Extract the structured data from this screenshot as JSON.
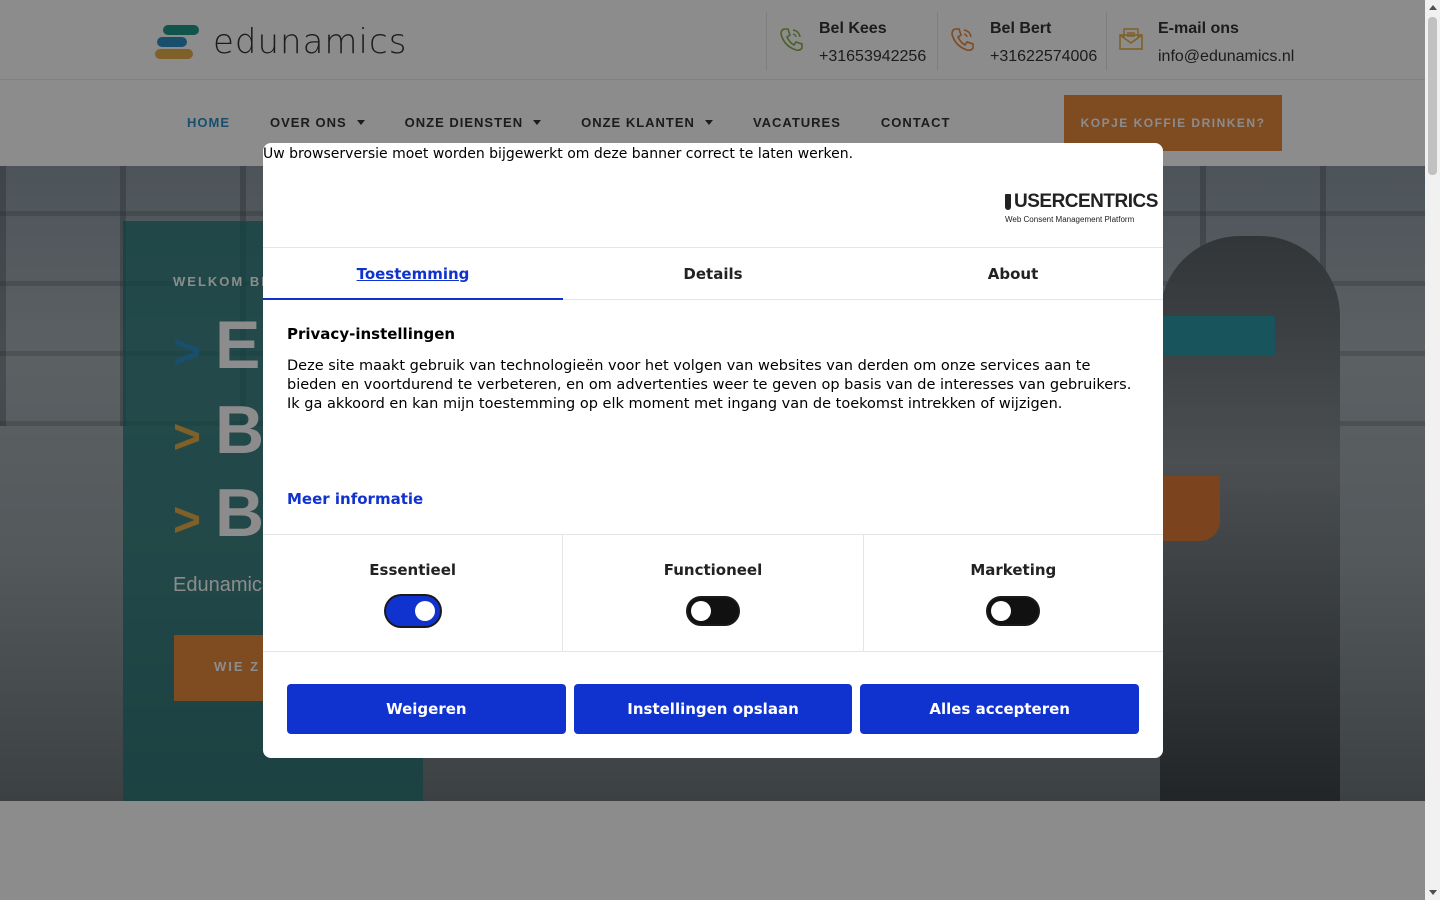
{
  "header": {
    "logo_text": "edunamics",
    "contacts": [
      {
        "title": "Bel Kees",
        "value": "+31653942256",
        "icon": "phone-icon",
        "color": "#8ab04a"
      },
      {
        "title": "Bel Bert",
        "value": "+31622574006",
        "icon": "phone-icon",
        "color": "#e8893c"
      },
      {
        "title": "E-mail ons",
        "value": "info@edunamics.nl",
        "icon": "mail-icon",
        "color": "#e8b04a"
      }
    ]
  },
  "nav": {
    "items": [
      {
        "label": "HOME"
      },
      {
        "label": "OVER ONS"
      },
      {
        "label": "ONZE DIENSTEN"
      },
      {
        "label": "ONZE KLANTEN"
      },
      {
        "label": "VACATURES"
      },
      {
        "label": "CONTACT"
      }
    ],
    "cta": "KOPJE KOFFIE DRINKEN?"
  },
  "hero": {
    "welcome": "WELKOM BIJ",
    "lines": [
      {
        "chevron": ">",
        "text": "E",
        "color": "#2e8fc5"
      },
      {
        "chevron": ">",
        "text": "B",
        "color": "#e8b04a"
      },
      {
        "chevron": ">",
        "text": "B",
        "color": "#e8b04a"
      }
    ],
    "subtitle": "Edunamics",
    "button": "WIE Z"
  },
  "consent": {
    "browser_warning": "Uw browserversie moet worden bijgewerkt om deze banner correct te laten werken.",
    "brand_name": "USERCENTRICS",
    "brand_tagline": "Web Consent Management Platform",
    "tabs": [
      {
        "label": "Toestemming"
      },
      {
        "label": "Details"
      },
      {
        "label": "About"
      }
    ],
    "title": "Privacy-instellingen",
    "body": "Deze site maakt gebruik van technologieën voor het volgen van websites van derden om onze services aan te bieden en voortdurend te verbeteren, en om advertenties weer te geven op basis van de interesses van gebruikers. Ik ga akkoord en kan mijn toestemming op elk moment met ingang van de toekomst intrekken of wijzigen.",
    "more_info": "Meer informatie",
    "categories": [
      {
        "label": "Essentieel",
        "enabled": true
      },
      {
        "label": "Functioneel",
        "enabled": false
      },
      {
        "label": "Marketing",
        "enabled": false
      }
    ],
    "buttons": {
      "deny": "Weigeren",
      "save": "Instellingen opslaan",
      "accept_all": "Alles accepteren"
    },
    "accent_color": "#1032cf"
  }
}
